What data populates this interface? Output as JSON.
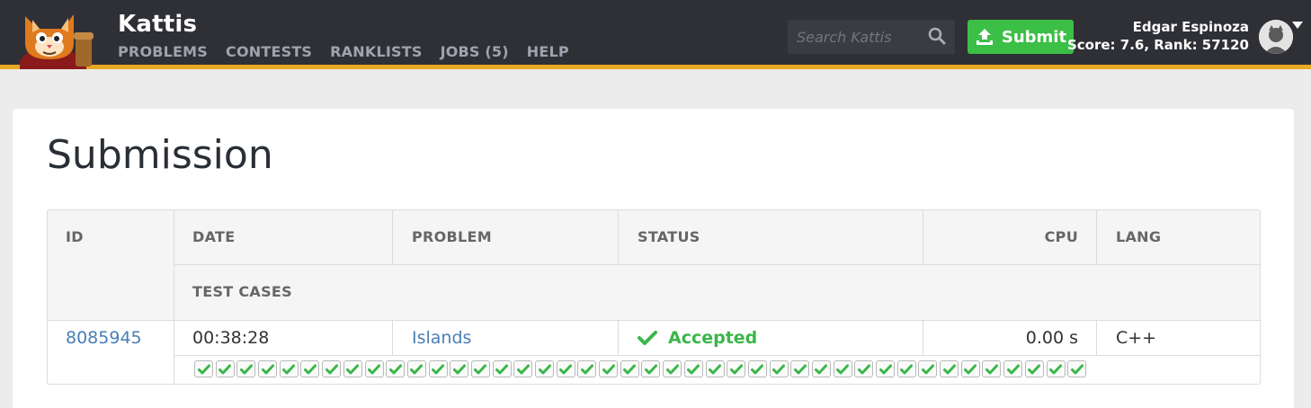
{
  "header": {
    "brand": "Kattis",
    "nav": [
      "PROBLEMS",
      "CONTESTS",
      "RANKLISTS",
      "JOBS (5)",
      "HELP"
    ],
    "search_placeholder": "Search Kattis",
    "submit_label": "Submit",
    "user_name": "Edgar Espinoza",
    "user_score": "Score: 7.6, Rank: 57120",
    "accent_color": "#e7a824"
  },
  "page": {
    "title": "Submission"
  },
  "table": {
    "headers": {
      "id": "ID",
      "date": "DATE",
      "problem": "PROBLEM",
      "status": "STATUS",
      "cpu": "CPU",
      "lang": "LANG",
      "test_cases": "TEST CASES"
    },
    "row": {
      "id": "8085945",
      "date": "00:38:28",
      "problem": "Islands",
      "status": "Accepted",
      "cpu": "0.00 s",
      "lang": "C++",
      "status_color": "#3bb649"
    },
    "test_cases": {
      "total": 42,
      "passed": 42,
      "icon": "check-icon"
    }
  }
}
